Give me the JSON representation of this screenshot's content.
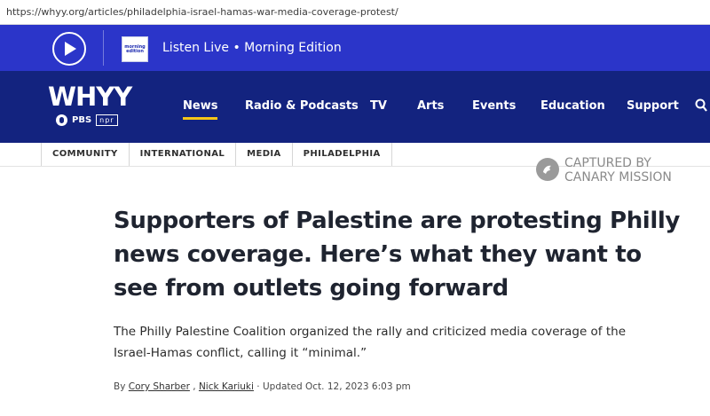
{
  "browser": {
    "url": "https://whyy.org/articles/philadelphia-israel-hamas-war-media-coverage-protest/"
  },
  "live_bar": {
    "play_icon": "play-icon",
    "show_thumb_line1": "morning",
    "show_thumb_line2": "edition",
    "text": "Listen Live • Morning Edition",
    "background": "#2b35c9"
  },
  "header": {
    "logo_text": "WHYY",
    "partner_pbs": "PBS",
    "partner_npr": "npr",
    "background": "#13237f",
    "accent": "#f5c518",
    "nav_items": [
      {
        "label": "News",
        "active": true
      },
      {
        "label": "Radio & Podcasts"
      },
      {
        "label": "TV"
      },
      {
        "label": "Arts"
      },
      {
        "label": "Events"
      },
      {
        "label": "Education"
      },
      {
        "label": "Support"
      }
    ],
    "search_icon": "search-icon"
  },
  "tags": [
    "COMMUNITY",
    "INTERNATIONAL",
    "MEDIA",
    "PHILADELPHIA"
  ],
  "watermark": {
    "line1": "CAPTURED BY",
    "line2": "CANARY MISSION"
  },
  "article": {
    "headline": "Supporters of Palestine are protesting Philly news coverage. Here’s what they want to see from outlets going forward",
    "dek": "The Philly Palestine Coalition organized the rally and criticized media coverage of the Israel-Hamas conflict, calling it “minimal.”",
    "byline_prefix": "By",
    "authors": [
      "Cory Sharber",
      "Nick Kariuki"
    ],
    "separator": "·",
    "updated": "Updated Oct. 12, 2023 6:03 pm"
  }
}
